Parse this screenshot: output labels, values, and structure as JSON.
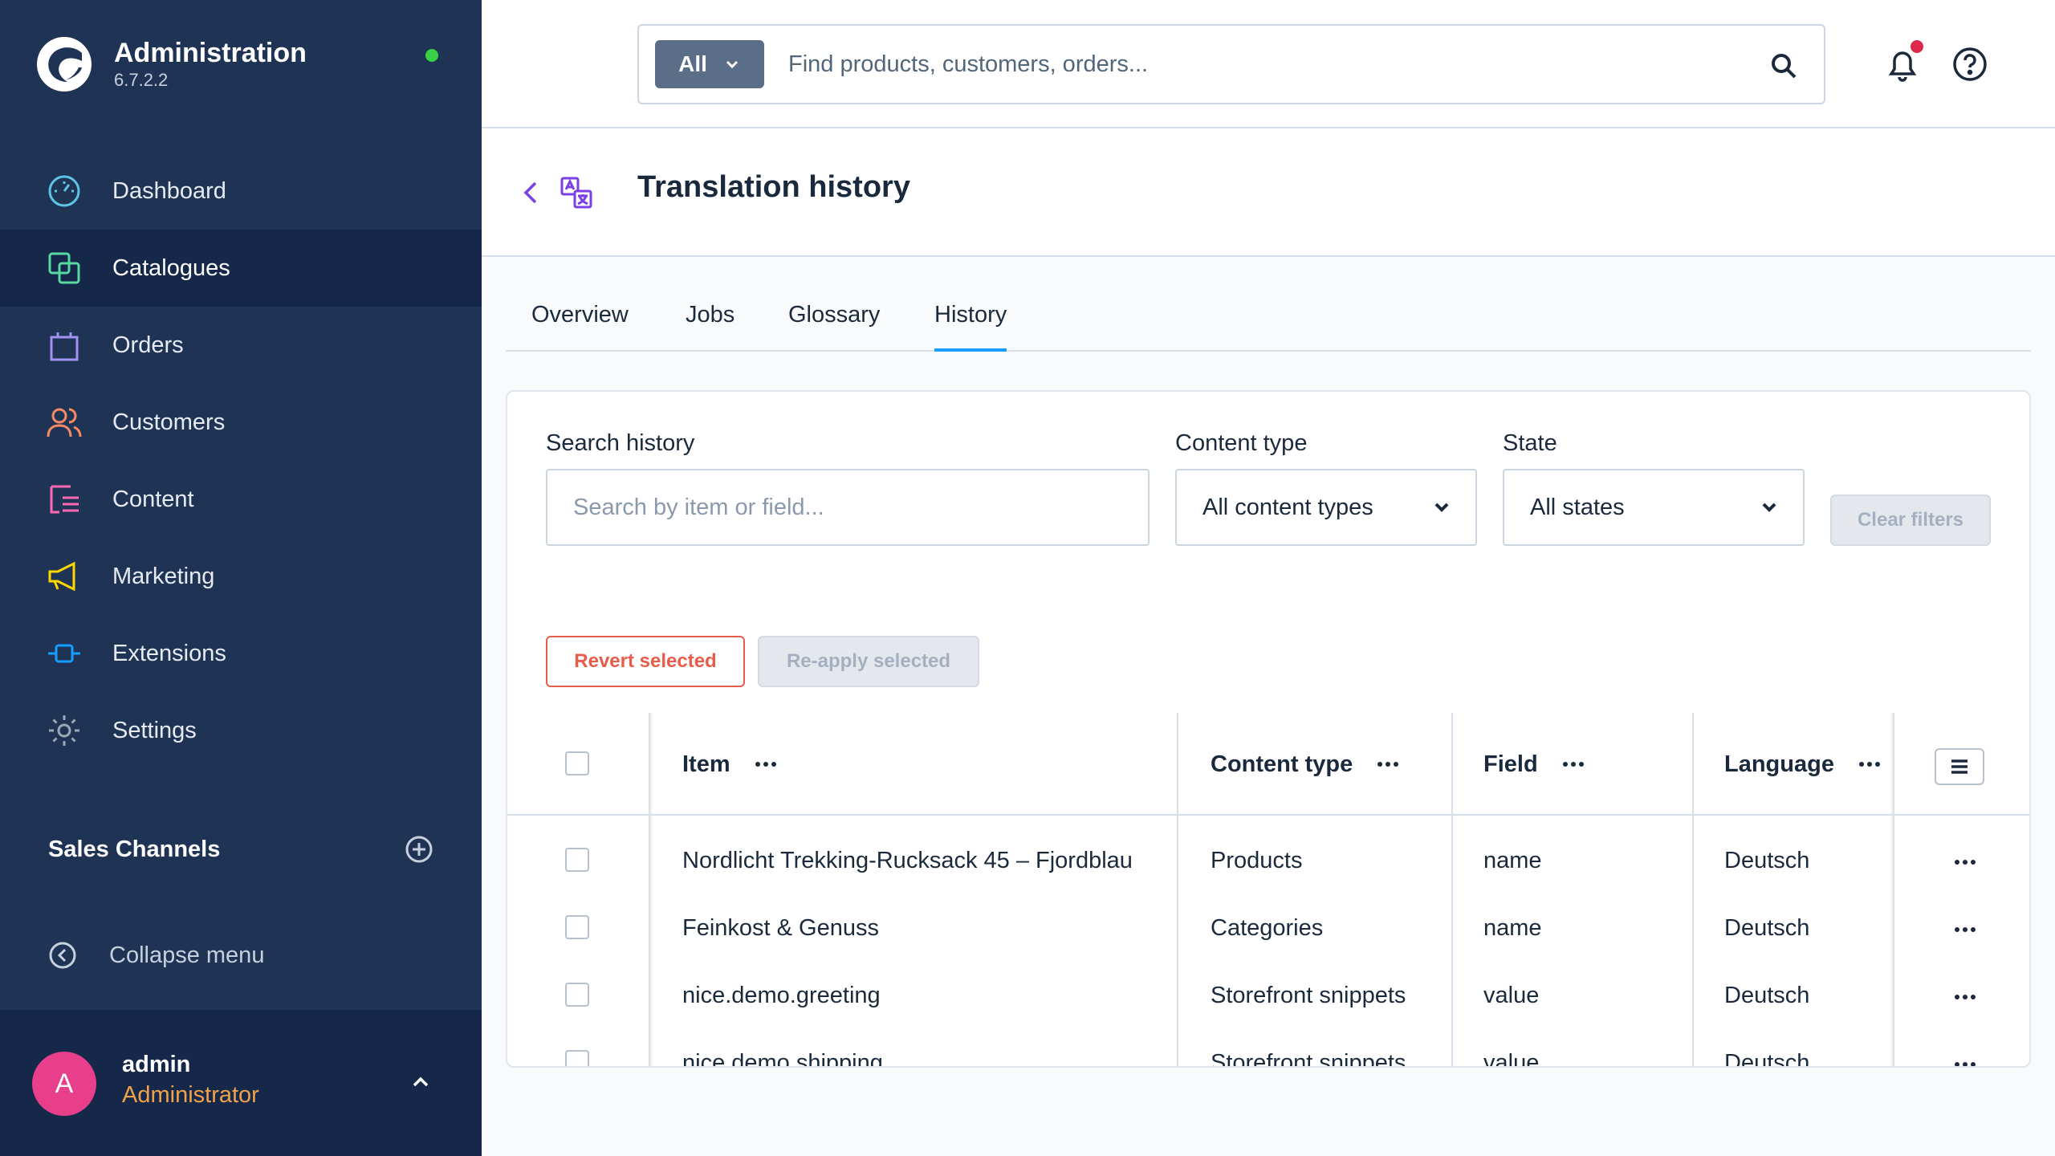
{
  "app": {
    "title": "Administration",
    "version": "6.7.2.2"
  },
  "sidebar": {
    "items": [
      {
        "label": "Dashboard",
        "icon": "dashboard-gauge-icon",
        "color": "#5ec4e6"
      },
      {
        "label": "Catalogues",
        "icon": "catalogue-icon",
        "color": "#57d9a3"
      },
      {
        "label": "Orders",
        "icon": "shopping-bag-icon",
        "color": "#a092f0"
      },
      {
        "label": "Customers",
        "icon": "customers-icon",
        "color": "#f88962"
      },
      {
        "label": "Content",
        "icon": "content-icon",
        "color": "#ff68b4"
      },
      {
        "label": "Marketing",
        "icon": "megaphone-icon",
        "color": "#ffd700"
      },
      {
        "label": "Extensions",
        "icon": "plug-icon",
        "color": "#189eff"
      },
      {
        "label": "Settings",
        "icon": "gear-icon",
        "color": "#9aa8b5"
      }
    ],
    "active_item": "Catalogues",
    "sales_channels_title": "Sales Channels",
    "collapse_label": "Collapse menu"
  },
  "user": {
    "initial": "A",
    "name": "admin",
    "role": "Administrator"
  },
  "search": {
    "scope_label": "All",
    "placeholder": "Find products, customers, orders..."
  },
  "page": {
    "title": "Translation history"
  },
  "tabs": [
    {
      "label": "Overview"
    },
    {
      "label": "Jobs"
    },
    {
      "label": "Glossary"
    },
    {
      "label": "History",
      "active": true
    }
  ],
  "filters": {
    "search_label": "Search history",
    "search_placeholder": "Search by item or field...",
    "content_type_label": "Content type",
    "content_type_value": "All content types",
    "state_label": "State",
    "state_value": "All states",
    "clear_label": "Clear filters"
  },
  "actions": {
    "revert_label": "Revert selected",
    "reapply_label": "Re-apply selected"
  },
  "table": {
    "columns": [
      "Item",
      "Content type",
      "Field",
      "Language"
    ],
    "rows": [
      {
        "item": "Nordlicht Trekking-Rucksack 45 – Fjordblau",
        "content_type": "Products",
        "field": "name",
        "language": "Deutsch"
      },
      {
        "item": "Feinkost & Genuss",
        "content_type": "Categories",
        "field": "name",
        "language": "Deutsch"
      },
      {
        "item": "nice.demo.greeting",
        "content_type": "Storefront snippets",
        "field": "value",
        "language": "Deutsch"
      },
      {
        "item": "nice.demo.shipping",
        "content_type": "Storefront snippets",
        "field": "value",
        "language": "Deutsch"
      }
    ]
  },
  "colors": {
    "sidebar_bg": "#1f3355",
    "accent": "#189eff",
    "danger": "#e85c4a",
    "avatar": "#e83e8c",
    "role": "#f0a14a",
    "online": "#37d046"
  }
}
